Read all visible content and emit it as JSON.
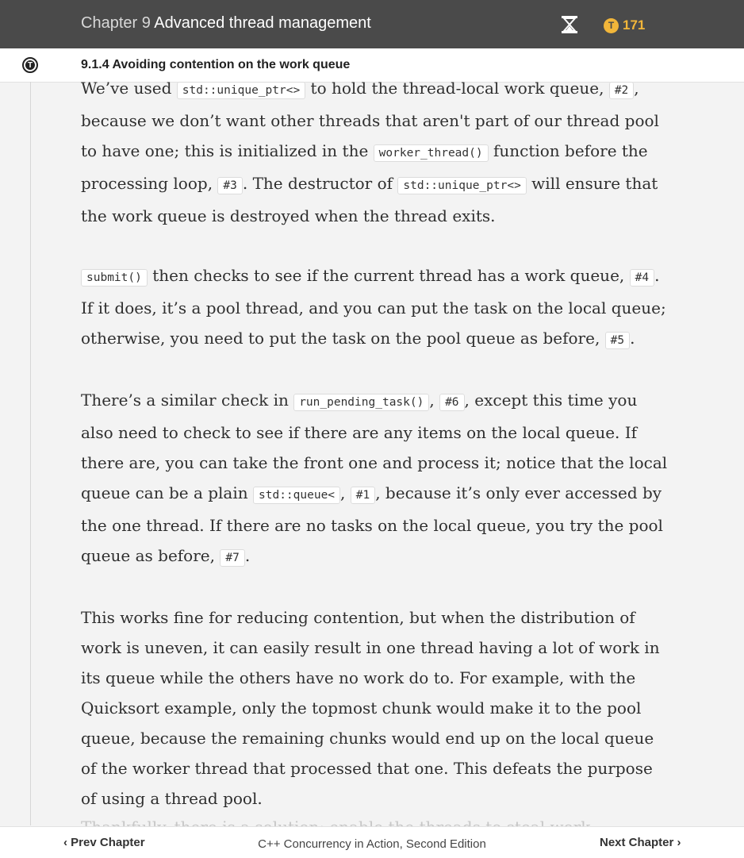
{
  "header": {
    "chapter_label": "Chapter 9",
    "chapter_title": "Advanced thread management",
    "tokens": "171",
    "token_icon_letter": "T"
  },
  "section": {
    "title": "9.1.4  Avoiding contention on the work queue",
    "logo_letter": "T"
  },
  "paragraphs": {
    "p1": {
      "t1": "We’ve used ",
      "c1": "std::unique_ptr<>",
      "t2": " to hold the thread-local work queue, ",
      "c2": "#2",
      "t3": ", because we don’t want other threads that aren't part of our thread pool to have one; this is initialized in the ",
      "c3": "worker_thread()",
      "t4": " function before the processing loop, ",
      "c4": "#3",
      "t5": ". The destructor of ",
      "c5": "std::unique_ptr<>",
      "t6": " will ensure that the work queue is destroyed when the thread exits."
    },
    "p2": {
      "c1": "submit()",
      "t1": " then checks to see if the current thread has a work queue, ",
      "c2": "#4",
      "t2": ". If it does, it’s a pool thread, and you can put the task on the local queue; otherwise, you need to put the task on the pool queue as before, ",
      "c3": "#5",
      "t3": "."
    },
    "p3": {
      "t1": "There’s a similar check in ",
      "c1": "run_pending_task()",
      "t2": ", ",
      "c2": "#6",
      "t3": ", except this time you also need to check to see if there are any items on the local queue. If there are, you can take the front one and process it; notice that the local queue can be a plain ",
      "c3": "std::queue<",
      "t4": ", ",
      "c4": "#1",
      "t5": ", because it’s only ever accessed by the one thread. If there are no tasks on the local queue, you try the pool queue as before, ",
      "c5": "#7",
      "t6": "."
    },
    "p4": "This works fine for reducing contention, but when the distribution of work is uneven, it can easily result in one thread having a lot of work in its queue while the others have no work do to. For example, with the Quicksort example, only the topmost chunk would make it to the pool queue, because the remaining chunks would end up on the local queue of the worker thread that processed that one. This defeats the purpose of using a thread pool.",
    "p5_faded": "Thankfully, there is a solution: enable the threads to steal work."
  },
  "footer": {
    "prev_label": "Prev Chapter",
    "book_title": "C++ Concurrency in Action, Second Edition",
    "next_label": "Next Chapter"
  },
  "colors": {
    "topbar": "#4a4a4a",
    "token_accent": "#f2b63a",
    "page_bg": "#f3f3f3"
  },
  "icons": [
    "hourglass-icon",
    "token-icon",
    "manning-logo-icon",
    "chevron-left-icon",
    "chevron-right-icon"
  ]
}
